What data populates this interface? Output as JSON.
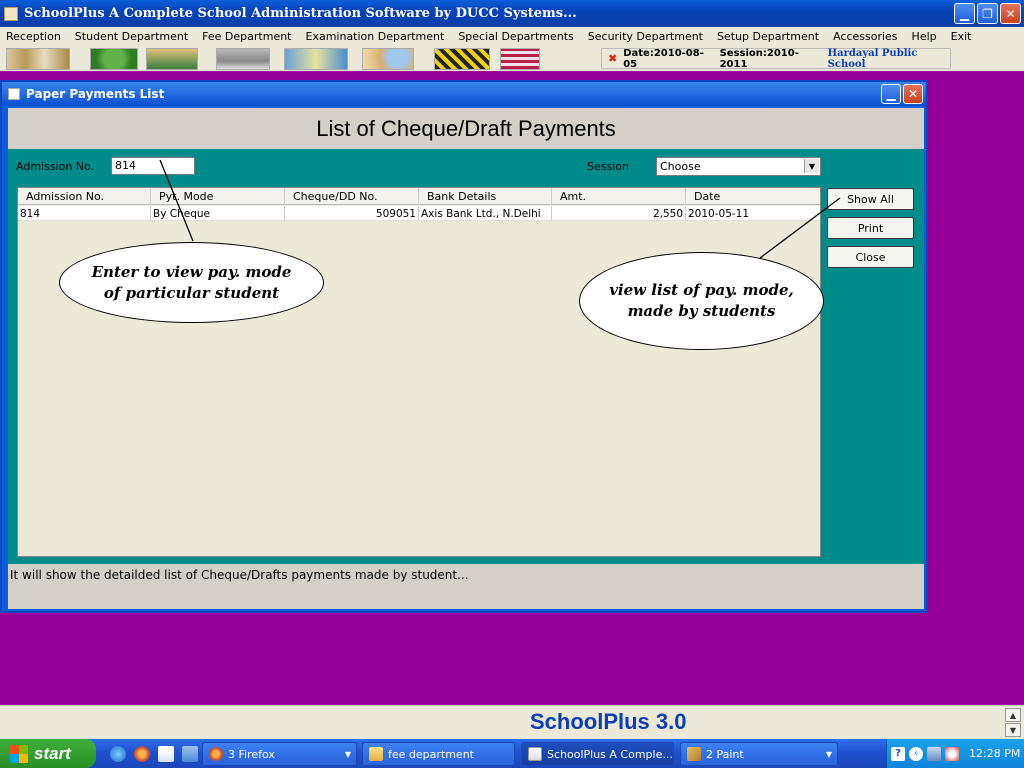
{
  "app": {
    "title": "SchoolPlus   A Complete School Administration Software by DUCC Systems...",
    "minimize_glyph": "▁",
    "restore_glyph": "❐",
    "close_glyph": "✕"
  },
  "menu": [
    "Reception",
    "Student Department",
    "Fee Department",
    "Examination Department",
    "Special  Departments",
    "Security Department",
    "Setup Department",
    "Accessories",
    "Help",
    "Exit"
  ],
  "status": {
    "icon": "close-x-icon",
    "date": "Date:2010-08-05",
    "session": "Session:2010-2011",
    "school": "Hardayal Public School"
  },
  "window": {
    "title": "Paper Payments List",
    "heading": "List of Cheque/Draft Payments",
    "admission_label": "Admission No.",
    "admission_value": "814",
    "session_label": "Session",
    "session_value": "Choose",
    "footer_text": "It will show the detailded list of Cheque/Drafts payments made by student..."
  },
  "table": {
    "columns": [
      "Admission No.",
      "Pyt. Mode",
      "Cheque/DD No.",
      "Bank Details",
      "Amt.",
      "Date"
    ],
    "rows": [
      [
        "814",
        "By Cheque",
        "509051",
        "Axis Bank Ltd., N.Delhi",
        "2,550",
        "2010-05-11"
      ]
    ]
  },
  "buttons": {
    "show_all": "Show All",
    "print": "Print",
    "close": "Close"
  },
  "callouts": {
    "left": "Enter to view pay. mode of particular student",
    "right": "view list of  pay. mode, made by students"
  },
  "brand": "SchoolPlus 3.0",
  "taskbar": {
    "start": "start",
    "tasks": [
      {
        "label": "3 Firefox",
        "icon": "firefox-icon"
      },
      {
        "label": "fee department",
        "icon": "folder-icon"
      },
      {
        "label": "SchoolPlus   A Comple...",
        "icon": "java-icon"
      },
      {
        "label": "2 Paint",
        "icon": "paint-icon"
      }
    ],
    "clock": "12:28 PM"
  }
}
